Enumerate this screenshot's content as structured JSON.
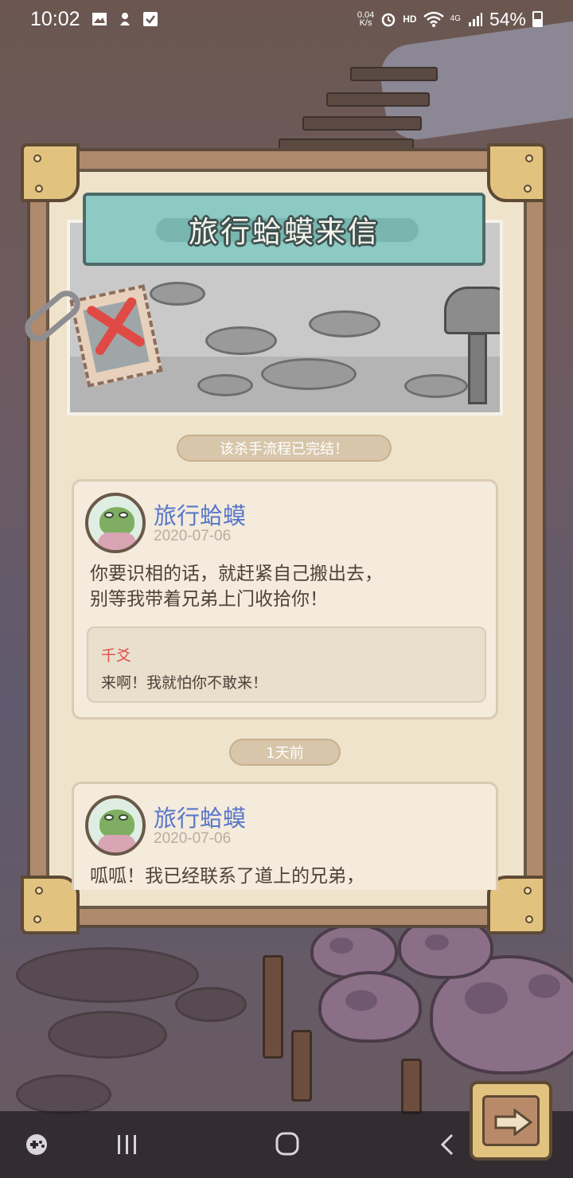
{
  "status_bar": {
    "time": "10:02",
    "net_speed_value": "0.04",
    "net_speed_unit": "K/s",
    "hd": "HD",
    "signal_type": "4G",
    "battery": "54%"
  },
  "letter": {
    "title": "旅行蛤蟆来信",
    "system_notice": "该杀手流程已完结！",
    "messages": [
      {
        "sender": "旅行蛤蟆",
        "date": "2020-07-06",
        "line1": "你要识相的话，就赶紧自己搬出去，",
        "line2": "别等我带着兄弟上门收拾你！",
        "reply": {
          "name": "千爻",
          "text": "来啊！我就怕你不敢来！"
        }
      },
      {
        "sender": "旅行蛤蟆",
        "date": "2020-07-06",
        "line1": "呱呱！我已经联系了道上的兄弟，"
      }
    ],
    "time_divider": "1天前"
  },
  "colors": {
    "sender_blue": "#5a78c9",
    "reply_red": "#e0504a",
    "banner_teal": "#8ccac3",
    "paper": "#efe3cb"
  },
  "icons": {
    "next": "arrow-right-icon",
    "nav_game": "game-launcher-icon",
    "nav_recent": "recent-apps-icon",
    "nav_home": "home-icon",
    "nav_back": "back-icon"
  }
}
